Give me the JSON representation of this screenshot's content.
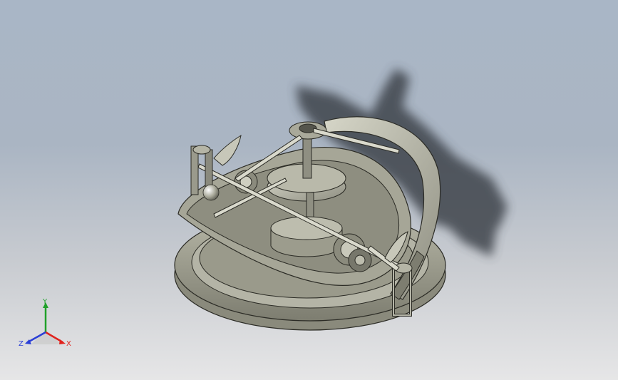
{
  "viewport": {
    "background_top": "#a9b6c6",
    "background_bottom": "#e6e6e7",
    "model_color": "#9c9c8c",
    "shadow_color": "#3a3f47"
  },
  "triad": {
    "x_label": "X",
    "y_label": "Y",
    "z_label": "Z",
    "x_color": "#e0231e",
    "y_color": "#20a12a",
    "z_color": "#2a3fd6"
  }
}
